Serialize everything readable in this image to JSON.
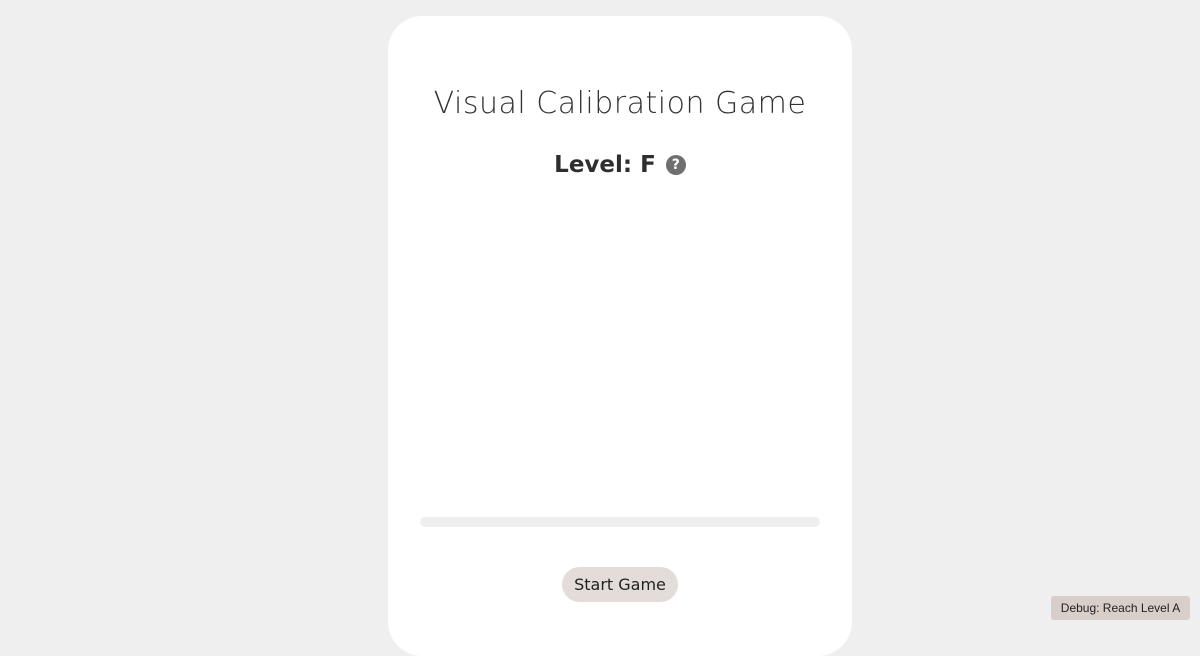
{
  "game": {
    "title": "Visual Calibration Game",
    "level_label": "Level: F",
    "help_symbol": "?",
    "progress_fraction": 0,
    "start_button_label": "Start Game"
  },
  "debug": {
    "button_label": "Debug: Reach Level A"
  },
  "icons": {
    "help": "help-icon"
  },
  "colors": {
    "page_background": "#efefef",
    "card_background": "#ffffff",
    "button_background": "#e4dcd8",
    "help_icon": "#6f6f6f",
    "progress_track": "#efefef"
  }
}
